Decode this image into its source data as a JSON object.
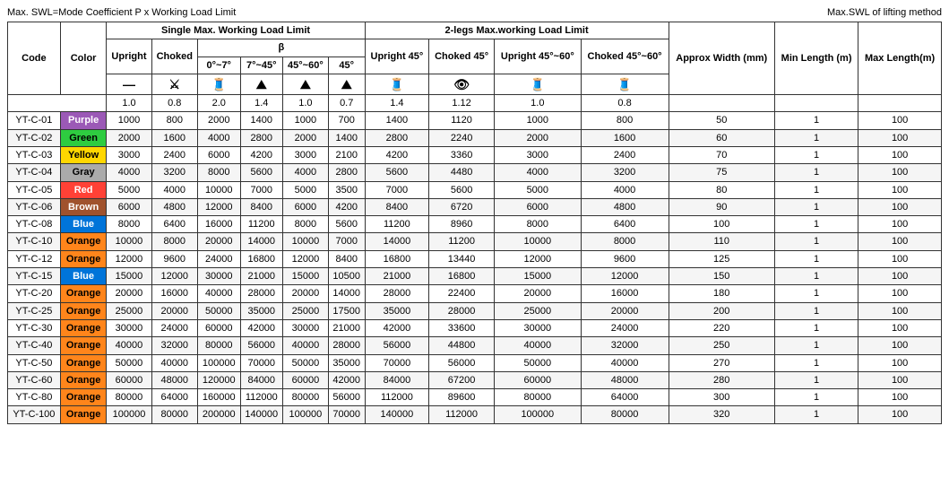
{
  "title_left": "Max. SWL=Mode Coefficient P x Working Load Limit",
  "title_right": "Max.SWL of lifting method",
  "columns": {
    "single_header": "Single Max. Working Load Limit",
    "two_legs_header": "2-legs Max.working Load Limit",
    "beta": "β",
    "single_cols": [
      "Upright",
      "Choked",
      "0°~7°",
      "7°~45°",
      "45°~60°",
      "45°"
    ],
    "two_legs_cols": [
      "Upright 45°",
      "Choked 45°",
      "Upright 45°~60°",
      "Choked 45°~60°"
    ],
    "approx": "Approx Width (mm)",
    "min_length": "Min Length (m)",
    "max_length": "Max Length(m)"
  },
  "multipliers": [
    "1.0",
    "0.8",
    "2.0",
    "1.4",
    "1.0",
    "0.7",
    "1.4",
    "1.12",
    "1.0",
    "0.8"
  ],
  "rows": [
    {
      "code": "YT-C-01",
      "color": "Purple",
      "colorClass": "purple-bg",
      "vals": [
        "1000",
        "800",
        "2000",
        "1400",
        "1000",
        "700",
        "1400",
        "1120",
        "1000",
        "800",
        "50",
        "1",
        "100"
      ]
    },
    {
      "code": "YT-C-02",
      "color": "Green",
      "colorClass": "green-bg",
      "vals": [
        "2000",
        "1600",
        "4000",
        "2800",
        "2000",
        "1400",
        "2800",
        "2240",
        "2000",
        "1600",
        "60",
        "1",
        "100"
      ]
    },
    {
      "code": "YT-C-03",
      "color": "Yellow",
      "colorClass": "yellow-bg",
      "vals": [
        "3000",
        "2400",
        "6000",
        "4200",
        "3000",
        "2100",
        "4200",
        "3360",
        "3000",
        "2400",
        "70",
        "1",
        "100"
      ]
    },
    {
      "code": "YT-C-04",
      "color": "Gray",
      "colorClass": "gray-bg",
      "vals": [
        "4000",
        "3200",
        "8000",
        "5600",
        "4000",
        "2800",
        "5600",
        "4480",
        "4000",
        "3200",
        "75",
        "1",
        "100"
      ]
    },
    {
      "code": "YT-C-05",
      "color": "Red",
      "colorClass": "red-bg",
      "vals": [
        "5000",
        "4000",
        "10000",
        "7000",
        "5000",
        "3500",
        "7000",
        "5600",
        "5000",
        "4000",
        "80",
        "1",
        "100"
      ]
    },
    {
      "code": "YT-C-06",
      "color": "Brown",
      "colorClass": "brown-bg",
      "vals": [
        "6000",
        "4800",
        "12000",
        "8400",
        "6000",
        "4200",
        "8400",
        "6720",
        "6000",
        "4800",
        "90",
        "1",
        "100"
      ]
    },
    {
      "code": "YT-C-08",
      "color": "Blue",
      "colorClass": "blue-bg",
      "vals": [
        "8000",
        "6400",
        "16000",
        "11200",
        "8000",
        "5600",
        "11200",
        "8960",
        "8000",
        "6400",
        "100",
        "1",
        "100"
      ]
    },
    {
      "code": "YT-C-10",
      "color": "Orange",
      "colorClass": "orange-bg",
      "vals": [
        "10000",
        "8000",
        "20000",
        "14000",
        "10000",
        "7000",
        "14000",
        "11200",
        "10000",
        "8000",
        "110",
        "1",
        "100"
      ]
    },
    {
      "code": "YT-C-12",
      "color": "Orange",
      "colorClass": "orange-bg",
      "vals": [
        "12000",
        "9600",
        "24000",
        "16800",
        "12000",
        "8400",
        "16800",
        "13440",
        "12000",
        "9600",
        "125",
        "1",
        "100"
      ]
    },
    {
      "code": "YT-C-15",
      "color": "Blue",
      "colorClass": "blue-bg",
      "vals": [
        "15000",
        "12000",
        "30000",
        "21000",
        "15000",
        "10500",
        "21000",
        "16800",
        "15000",
        "12000",
        "150",
        "1",
        "100"
      ]
    },
    {
      "code": "YT-C-20",
      "color": "Orange",
      "colorClass": "orange-bg",
      "vals": [
        "20000",
        "16000",
        "40000",
        "28000",
        "20000",
        "14000",
        "28000",
        "22400",
        "20000",
        "16000",
        "180",
        "1",
        "100"
      ]
    },
    {
      "code": "YT-C-25",
      "color": "Orange",
      "colorClass": "orange-bg",
      "vals": [
        "25000",
        "20000",
        "50000",
        "35000",
        "25000",
        "17500",
        "35000",
        "28000",
        "25000",
        "20000",
        "200",
        "1",
        "100"
      ]
    },
    {
      "code": "YT-C-30",
      "color": "Orange",
      "colorClass": "orange-bg",
      "vals": [
        "30000",
        "24000",
        "60000",
        "42000",
        "30000",
        "21000",
        "42000",
        "33600",
        "30000",
        "24000",
        "220",
        "1",
        "100"
      ]
    },
    {
      "code": "YT-C-40",
      "color": "Orange",
      "colorClass": "orange-bg",
      "vals": [
        "40000",
        "32000",
        "80000",
        "56000",
        "40000",
        "28000",
        "56000",
        "44800",
        "40000",
        "32000",
        "250",
        "1",
        "100"
      ]
    },
    {
      "code": "YT-C-50",
      "color": "Orange",
      "colorClass": "orange-bg",
      "vals": [
        "50000",
        "40000",
        "100000",
        "70000",
        "50000",
        "35000",
        "70000",
        "56000",
        "50000",
        "40000",
        "270",
        "1",
        "100"
      ]
    },
    {
      "code": "YT-C-60",
      "color": "Orange",
      "colorClass": "orange-bg",
      "vals": [
        "60000",
        "48000",
        "120000",
        "84000",
        "60000",
        "42000",
        "84000",
        "67200",
        "60000",
        "48000",
        "280",
        "1",
        "100"
      ]
    },
    {
      "code": "YT-C-80",
      "color": "Orange",
      "colorClass": "orange-bg",
      "vals": [
        "80000",
        "64000",
        "160000",
        "112000",
        "80000",
        "56000",
        "112000",
        "89600",
        "80000",
        "64000",
        "300",
        "1",
        "100"
      ]
    },
    {
      "code": "YT-C-100",
      "color": "Orange",
      "colorClass": "orange-bg",
      "vals": [
        "100000",
        "80000",
        "200000",
        "140000",
        "100000",
        "70000",
        "140000",
        "112000",
        "100000",
        "80000",
        "320",
        "1",
        "100"
      ]
    }
  ]
}
